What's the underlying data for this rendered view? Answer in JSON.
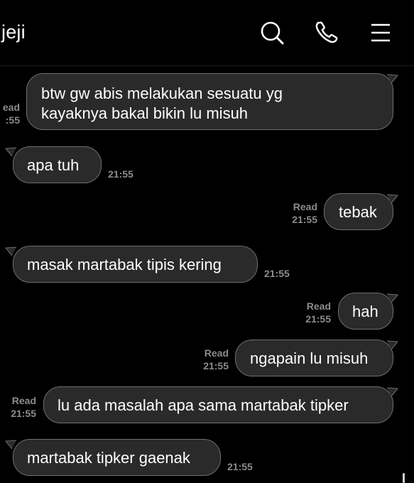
{
  "header": {
    "title": "jeji",
    "icons": [
      "search-icon",
      "phone-icon",
      "menu-icon"
    ]
  },
  "messages": [
    {
      "side": "out",
      "lines": [
        "btw gw abis melakukan sesuatu yg",
        "kayaknya bakal bikin lu misuh"
      ],
      "status": "ead",
      "time": ":55"
    },
    {
      "side": "in",
      "text": "apa tuh",
      "time": "21:55"
    },
    {
      "side": "out",
      "text": "tebak",
      "status": "Read",
      "time": "21:55"
    },
    {
      "side": "in",
      "text": "masak martabak tipis kering",
      "time": "21:55"
    },
    {
      "side": "out",
      "text": "hah",
      "status": "Read",
      "time": "21:55"
    },
    {
      "side": "out",
      "text": "ngapain lu misuh",
      "status": "Read",
      "time": "21:55"
    },
    {
      "side": "out",
      "text": "lu ada masalah apa sama martabak tipker",
      "status": "Read",
      "time": "21:55"
    },
    {
      "side": "in",
      "text": "martabak tipker gaenak",
      "time": "21:55"
    }
  ],
  "colors": {
    "background": "#000000",
    "bubble": "#2a2a2a",
    "bubble_border": "#6e6e6e",
    "meta_text": "#8c8c8c"
  }
}
